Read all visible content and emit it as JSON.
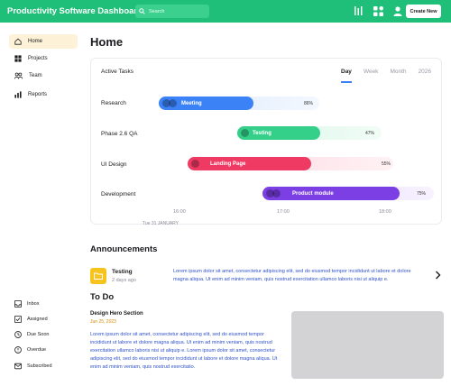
{
  "app": {
    "title": "Productivity Software Dashboard"
  },
  "search": {
    "placeholder": "Search"
  },
  "header": {
    "create_label": "Create New"
  },
  "sidebar": {
    "items": [
      {
        "label": "Home",
        "icon": "home-icon"
      },
      {
        "label": "Projects",
        "icon": "grid-icon"
      },
      {
        "label": "Team",
        "icon": "team-icon"
      },
      {
        "label": "Reports",
        "icon": "bar-chart-icon"
      }
    ],
    "bottom_items": [
      {
        "label": "Inbox",
        "icon": "inbox-icon"
      },
      {
        "label": "Assigned",
        "icon": "assigned-icon"
      },
      {
        "label": "Due Soon",
        "icon": "clock-icon"
      },
      {
        "label": "Overdue",
        "icon": "overdue-icon"
      },
      {
        "label": "Subscribed",
        "icon": "mail-icon"
      }
    ]
  },
  "main": {
    "title": "Home"
  },
  "tasks": {
    "title": "Active Tasks",
    "ranges": [
      "Day",
      "Week",
      "Month",
      "2026"
    ],
    "active_range": "Day",
    "rows": [
      {
        "label": "Research",
        "task": "Meeting",
        "progress_label": "86%",
        "color": "#3b82f6"
      },
      {
        "label": "Phase 2.6 QA",
        "task": "Testing",
        "progress_label": "47%",
        "color": "#34d08a"
      },
      {
        "label": "UI Design",
        "task": "Landing Page",
        "progress_label": "55%",
        "color": "#ef3b63"
      },
      {
        "label": "Development",
        "task": "Product module",
        "progress_label": "75%",
        "color": "#7b3fe4"
      }
    ],
    "times": [
      "16:00",
      "17:00",
      "18:00"
    ],
    "date": "Tue 31 JANUARY"
  },
  "announcements": {
    "title": "Announcements",
    "item": {
      "name": "Testing",
      "time": "2 days ago",
      "body": "Lorem ipsum dolor sit amet, consectetur adipiscing elit, sed do eiusmod  tempor incididunt ut labore et dolore magna aliqua. Ut enim ad minim  veniam, quis nostrud exercitation ullamco laboris nisi ut aliquip e."
    }
  },
  "todo": {
    "title": "To Do",
    "item": {
      "title": "Design Hero Section",
      "date": "Jun 25, 2023",
      "body": "Lorem ipsum dolor sit amet, consectetur adipiscing elit, sed do eiusmod  tempor incididunt ut labore et dolore magna aliqua. Ut enim ad minim  veniam, quis nostrud exercitation ullamco laboris nisi ut aliquip e. Lorem ipsum dolor sit amet, consectetur adipiscing elit, sed do eiusmod  tempor incididunt ut labore et dolore magna aliqua. Ut enim ad minim  veniam, quis nostrud exercitatio."
    }
  },
  "colors": {
    "brand": "#1fbf7a",
    "active_nav": "#fdf1d8",
    "link_text": "#2f52c8",
    "accent": "#3b7ef6"
  }
}
